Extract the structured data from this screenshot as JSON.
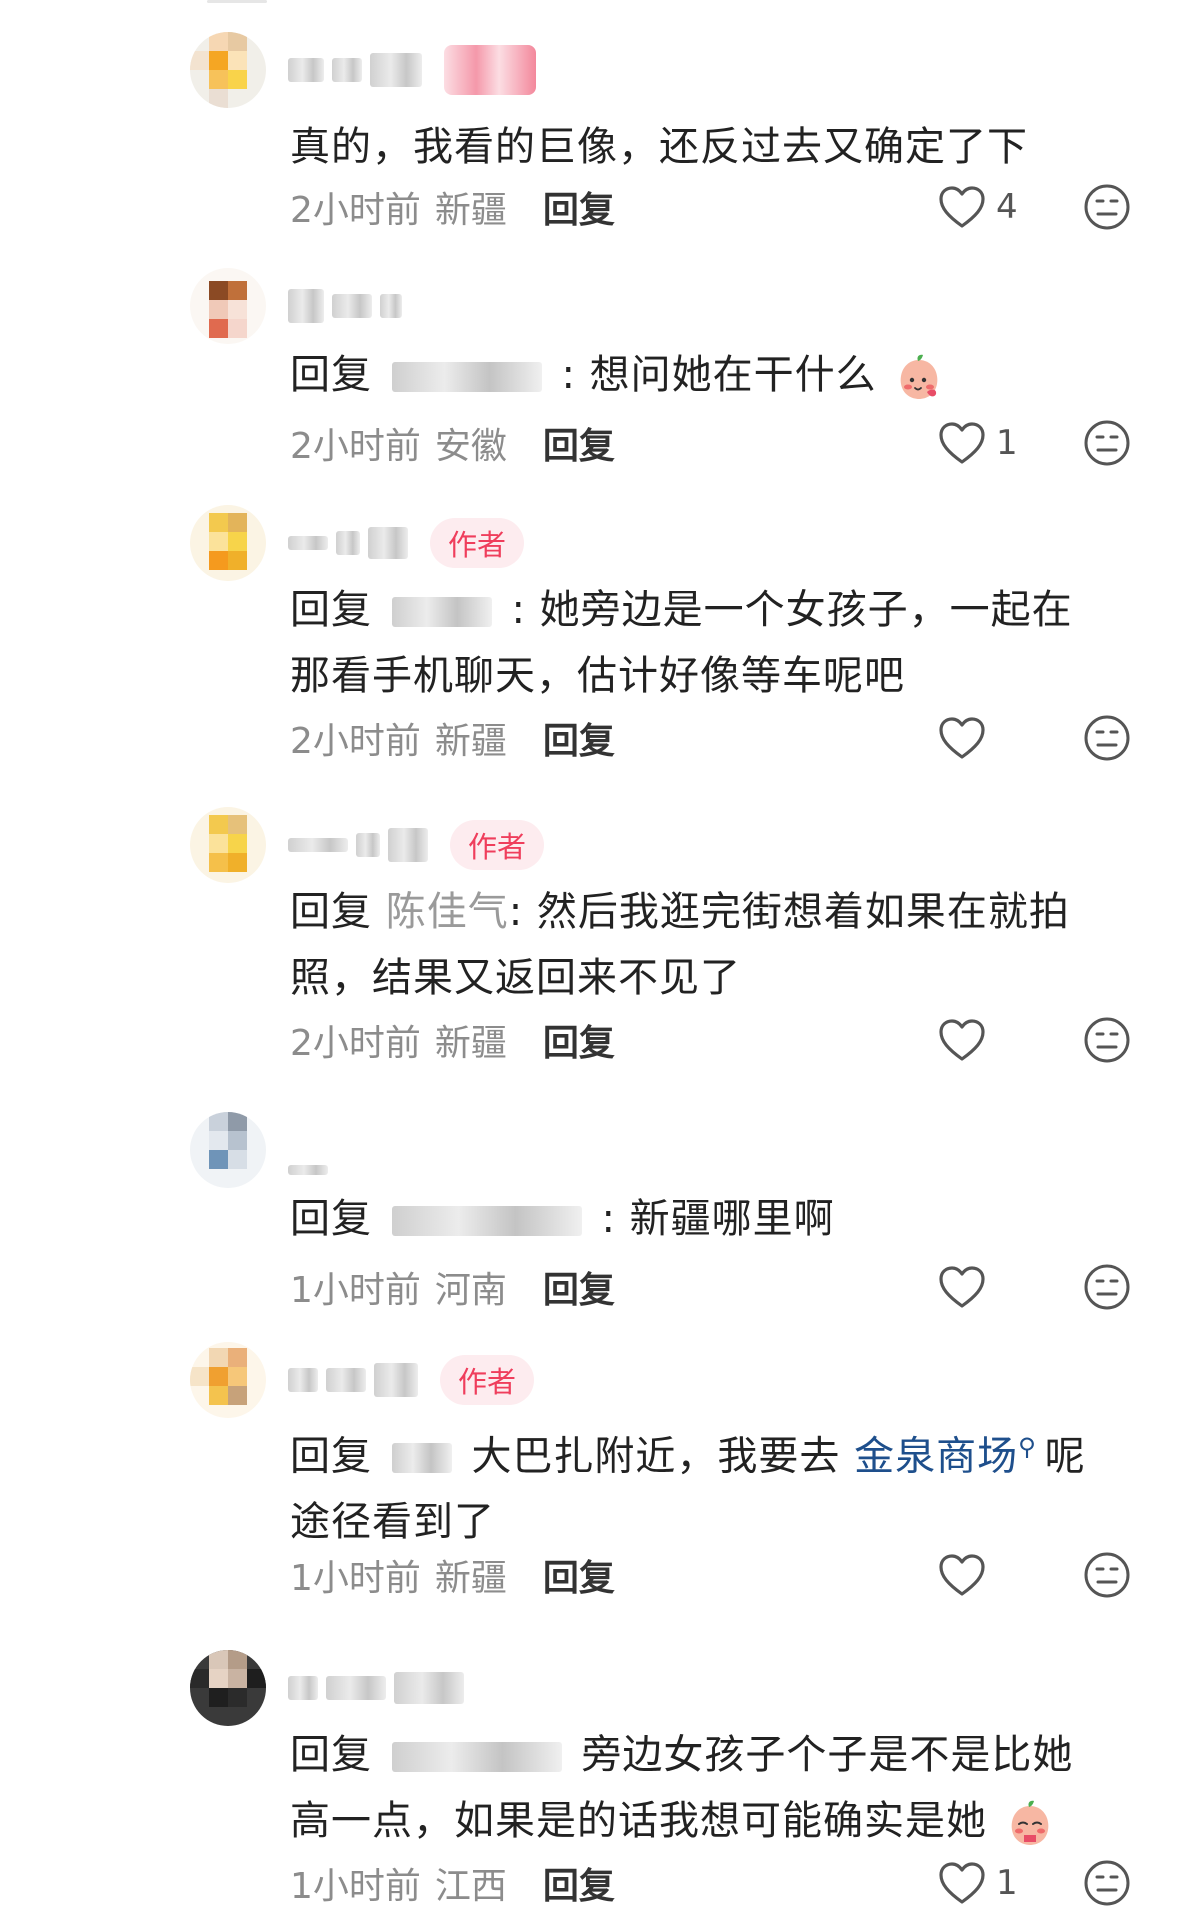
{
  "comments": [
    {
      "reply_prefix": "",
      "mention": "",
      "text": "真的，我看的巨像，还反过去又确定了下",
      "time": "2小时前",
      "region": "新疆",
      "reply_label": "回复",
      "likes": "4",
      "badge": "",
      "emoji": ""
    },
    {
      "reply_prefix": "回复",
      "mention": "",
      "text": ": 想问她在干什么",
      "time": "2小时前",
      "region": "安徽",
      "reply_label": "回复",
      "likes": "1",
      "badge": "",
      "emoji": "peach-emoji"
    },
    {
      "reply_prefix": "回复",
      "mention": "",
      "text": ": 她旁边是一个女孩子，一起在那看手机聊天，估计好像等车呢吧",
      "time": "2小时前",
      "region": "新疆",
      "reply_label": "回复",
      "likes": "",
      "badge": "作者",
      "emoji": ""
    },
    {
      "reply_prefix": "回复",
      "mention": "陈佳气",
      "text": ": 然后我逛完街想着如果在就拍照，结果又返回来不见了",
      "time": "2小时前",
      "region": "新疆",
      "reply_label": "回复",
      "likes": "",
      "badge": "作者",
      "emoji": ""
    },
    {
      "reply_prefix": "回复",
      "mention": "",
      "text": ": 新疆哪里啊",
      "time": "1小时前",
      "region": "河南",
      "reply_label": "回复",
      "likes": "",
      "badge": "",
      "emoji": ""
    },
    {
      "reply_prefix": "回复",
      "mention": "",
      "text": "大巴扎附近，我要去",
      "link": "金泉商场",
      "text_after": "呢途径看到了",
      "time": "1小时前",
      "region": "新疆",
      "reply_label": "回复",
      "likes": "",
      "badge": "作者",
      "emoji": ""
    },
    {
      "reply_prefix": "回复",
      "mention": "",
      "text": "旁边女孩子个子是不是比她高一点，如果是的话我想可能确实是她",
      "time": "1小时前",
      "region": "江西",
      "reply_label": "回复",
      "likes": "1",
      "badge": "",
      "emoji": "peach-emoji"
    }
  ],
  "colors": {
    "author_badge_bg": "#fdecef",
    "author_badge_text": "#ef3e5c",
    "link": "#1e4f8c",
    "meta": "#8c8c8c"
  },
  "icons": [
    "heart-outline-icon",
    "meh-face-icon",
    "search-icon"
  ]
}
